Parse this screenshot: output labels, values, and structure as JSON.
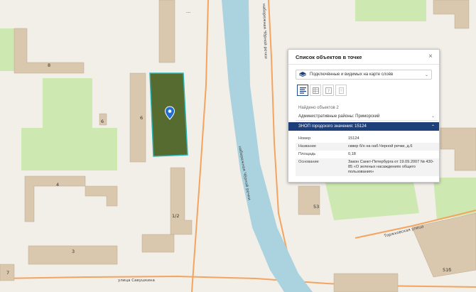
{
  "panel": {
    "title": "Список объектов в точке",
    "close_icon": "×",
    "layer_select": "Подключённые и видимых на карте слоёв",
    "found": "Найдено объектов 2",
    "admin_row": "Административные районы: Приморский",
    "znop_row": "ЗНОП городского значения: 15124",
    "properties": [
      {
        "key": "Номер",
        "value": "15124"
      },
      {
        "key": "Название",
        "value": "сквер б/н на наб.Черной речки, д.6"
      },
      {
        "key": "Площадь",
        "value": "0,18"
      },
      {
        "key": "Основание",
        "value": "Закон Санкт-Петербурга от 19.09.2007 № 430-85 «О зеленых насаждениях общего пользования»"
      }
    ]
  },
  "map": {
    "house_numbers": [
      "8",
      "6",
      "6",
      "4",
      "1/2",
      "3",
      "7",
      "53",
      "51б",
      "..."
    ],
    "streets": [
      "набережная Чёрной речки",
      "улица Савушкина",
      "Торжковская улица"
    ]
  },
  "colors": {
    "water": "#aad3df",
    "building": "#d9c7ae",
    "green": "#cde8b0",
    "road": "#f4a460",
    "park_fill": "#556b2f",
    "park_border": "#29b3b3",
    "header": "#1f3f7a"
  }
}
